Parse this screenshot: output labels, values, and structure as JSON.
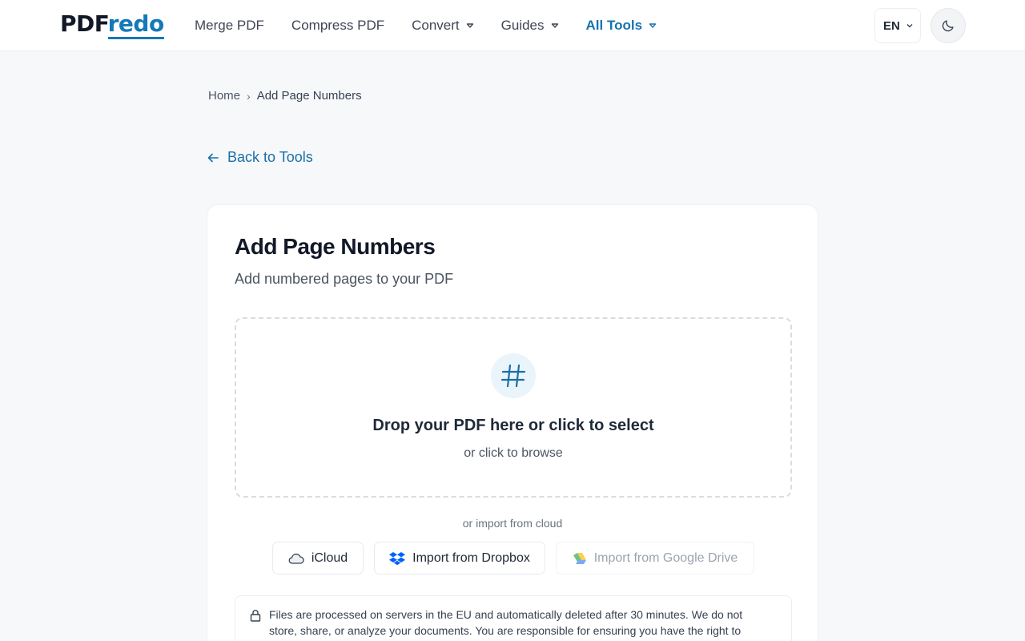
{
  "header": {
    "logo_part1": "PDF",
    "logo_part2": "redo",
    "nav": [
      {
        "label": "Merge PDF"
      },
      {
        "label": "Compress PDF"
      },
      {
        "label": "Convert"
      },
      {
        "label": "Guides"
      },
      {
        "label": "All Tools"
      }
    ],
    "language": "EN",
    "theme_icon": "moon-icon"
  },
  "breadcrumb": {
    "home": "Home",
    "current": "Add Page Numbers"
  },
  "back_link": "Back to Tools",
  "tool": {
    "title": "Add Page Numbers",
    "subtitle": "Add numbered pages to your PDF",
    "icon": "hash-icon",
    "drop_title": "Drop your PDF here or click to select",
    "drop_sub": "or click to browse",
    "cloud_label": "or import from cloud",
    "cloud_buttons": [
      {
        "label": "iCloud",
        "icon": "cloud-icon"
      },
      {
        "label": "Import from Dropbox",
        "icon": "dropbox-icon"
      },
      {
        "label": "Import from Google Drive",
        "icon": "google-drive-icon"
      }
    ],
    "notice": "Files are processed on servers in the EU and automatically deleted after 30 minutes. We do not store, share, or analyze your documents. You are responsible for ensuring you have the right to process"
  },
  "colors": {
    "accent": "#1479b8",
    "background": "#f7f8fa"
  }
}
